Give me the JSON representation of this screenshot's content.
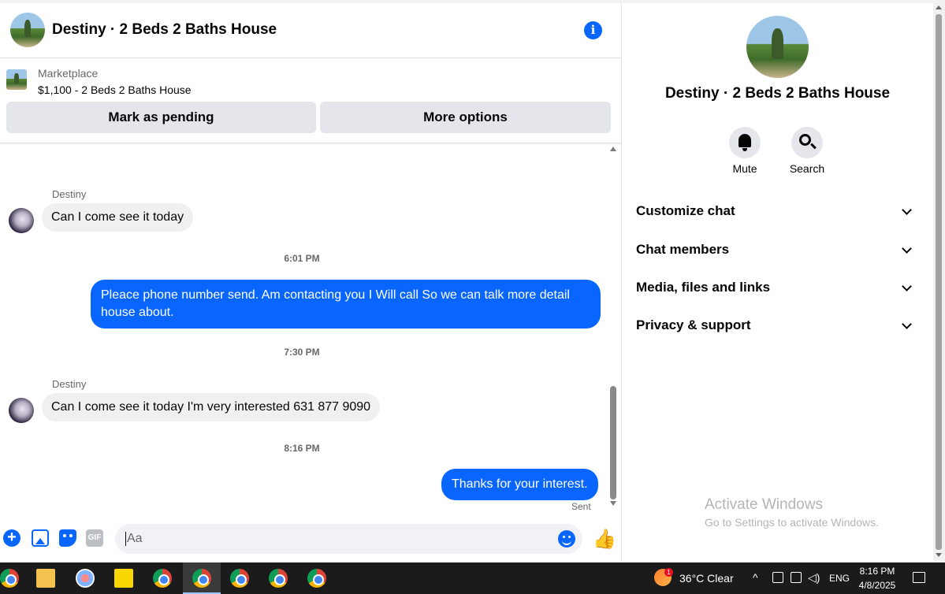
{
  "chat": {
    "title": "Destiny · 2 Beds 2 Baths House",
    "marketplace_label": "Marketplace",
    "listing": "$1,100 - 2 Beds 2 Baths House",
    "mark_pending_label": "Mark as pending",
    "more_options_label": "More options",
    "messages": [
      {
        "type": "in",
        "sender": "Destiny",
        "text": "Can I come see it today"
      },
      {
        "type": "time",
        "text": "6:01 PM"
      },
      {
        "type": "out",
        "text": "Pleace phone number send. Am contacting you I Will call So we can talk more detail house about."
      },
      {
        "type": "time",
        "text": "7:30 PM"
      },
      {
        "type": "in",
        "sender": "Destiny",
        "text": "Can I come see it today I'm very interested 631 877 9090"
      },
      {
        "type": "time",
        "text": "8:16 PM"
      },
      {
        "type": "out",
        "text": "Thanks for your interest."
      }
    ],
    "sent_status": "Sent",
    "composer_placeholder": "Aa",
    "gif_label": "GIF"
  },
  "side": {
    "title": "Destiny · 2 Beds 2 Baths House",
    "mute_label": "Mute",
    "search_label": "Search",
    "sections": [
      "Customize chat",
      "Chat members",
      "Media, files and links",
      "Privacy & support"
    ],
    "activate_title": "Activate Windows",
    "activate_sub": "Go to Settings to activate Windows."
  },
  "taskbar": {
    "weather": "36°C  Clear",
    "weather_badge": "1",
    "lang": "ENG",
    "time": "8:16 PM",
    "date": "4/8/2025"
  },
  "colors": {
    "accent": "#0866ff",
    "bubble_in": "#f0f0f0",
    "button_bg": "#e4e6eb"
  }
}
